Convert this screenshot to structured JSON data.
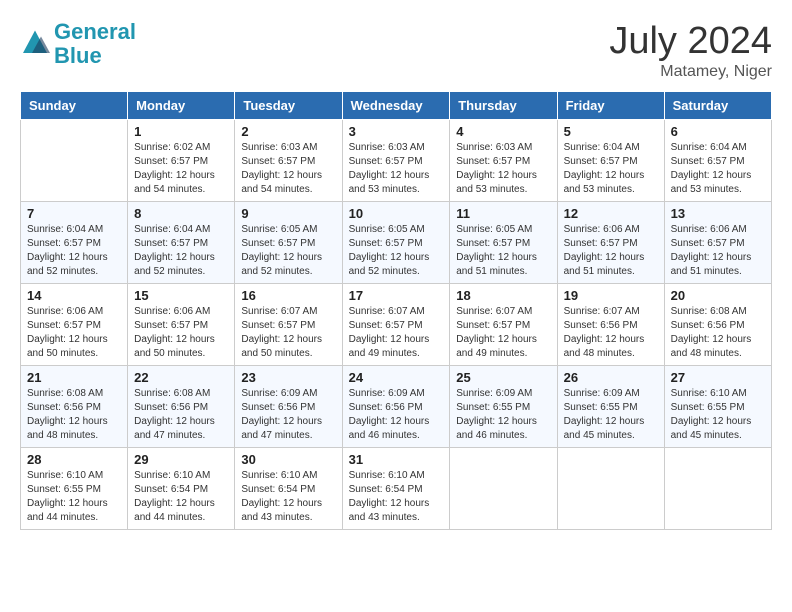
{
  "header": {
    "logo_line1": "General",
    "logo_line2": "Blue",
    "month_year": "July 2024",
    "location": "Matamey, Niger"
  },
  "weekdays": [
    "Sunday",
    "Monday",
    "Tuesday",
    "Wednesday",
    "Thursday",
    "Friday",
    "Saturday"
  ],
  "weeks": [
    [
      {
        "day": "",
        "info": ""
      },
      {
        "day": "1",
        "info": "Sunrise: 6:02 AM\nSunset: 6:57 PM\nDaylight: 12 hours\nand 54 minutes."
      },
      {
        "day": "2",
        "info": "Sunrise: 6:03 AM\nSunset: 6:57 PM\nDaylight: 12 hours\nand 54 minutes."
      },
      {
        "day": "3",
        "info": "Sunrise: 6:03 AM\nSunset: 6:57 PM\nDaylight: 12 hours\nand 53 minutes."
      },
      {
        "day": "4",
        "info": "Sunrise: 6:03 AM\nSunset: 6:57 PM\nDaylight: 12 hours\nand 53 minutes."
      },
      {
        "day": "5",
        "info": "Sunrise: 6:04 AM\nSunset: 6:57 PM\nDaylight: 12 hours\nand 53 minutes."
      },
      {
        "day": "6",
        "info": "Sunrise: 6:04 AM\nSunset: 6:57 PM\nDaylight: 12 hours\nand 53 minutes."
      }
    ],
    [
      {
        "day": "7",
        "info": "Sunrise: 6:04 AM\nSunset: 6:57 PM\nDaylight: 12 hours\nand 52 minutes."
      },
      {
        "day": "8",
        "info": "Sunrise: 6:04 AM\nSunset: 6:57 PM\nDaylight: 12 hours\nand 52 minutes."
      },
      {
        "day": "9",
        "info": "Sunrise: 6:05 AM\nSunset: 6:57 PM\nDaylight: 12 hours\nand 52 minutes."
      },
      {
        "day": "10",
        "info": "Sunrise: 6:05 AM\nSunset: 6:57 PM\nDaylight: 12 hours\nand 52 minutes."
      },
      {
        "day": "11",
        "info": "Sunrise: 6:05 AM\nSunset: 6:57 PM\nDaylight: 12 hours\nand 51 minutes."
      },
      {
        "day": "12",
        "info": "Sunrise: 6:06 AM\nSunset: 6:57 PM\nDaylight: 12 hours\nand 51 minutes."
      },
      {
        "day": "13",
        "info": "Sunrise: 6:06 AM\nSunset: 6:57 PM\nDaylight: 12 hours\nand 51 minutes."
      }
    ],
    [
      {
        "day": "14",
        "info": "Sunrise: 6:06 AM\nSunset: 6:57 PM\nDaylight: 12 hours\nand 50 minutes."
      },
      {
        "day": "15",
        "info": "Sunrise: 6:06 AM\nSunset: 6:57 PM\nDaylight: 12 hours\nand 50 minutes."
      },
      {
        "day": "16",
        "info": "Sunrise: 6:07 AM\nSunset: 6:57 PM\nDaylight: 12 hours\nand 50 minutes."
      },
      {
        "day": "17",
        "info": "Sunrise: 6:07 AM\nSunset: 6:57 PM\nDaylight: 12 hours\nand 49 minutes."
      },
      {
        "day": "18",
        "info": "Sunrise: 6:07 AM\nSunset: 6:57 PM\nDaylight: 12 hours\nand 49 minutes."
      },
      {
        "day": "19",
        "info": "Sunrise: 6:07 AM\nSunset: 6:56 PM\nDaylight: 12 hours\nand 48 minutes."
      },
      {
        "day": "20",
        "info": "Sunrise: 6:08 AM\nSunset: 6:56 PM\nDaylight: 12 hours\nand 48 minutes."
      }
    ],
    [
      {
        "day": "21",
        "info": "Sunrise: 6:08 AM\nSunset: 6:56 PM\nDaylight: 12 hours\nand 48 minutes."
      },
      {
        "day": "22",
        "info": "Sunrise: 6:08 AM\nSunset: 6:56 PM\nDaylight: 12 hours\nand 47 minutes."
      },
      {
        "day": "23",
        "info": "Sunrise: 6:09 AM\nSunset: 6:56 PM\nDaylight: 12 hours\nand 47 minutes."
      },
      {
        "day": "24",
        "info": "Sunrise: 6:09 AM\nSunset: 6:56 PM\nDaylight: 12 hours\nand 46 minutes."
      },
      {
        "day": "25",
        "info": "Sunrise: 6:09 AM\nSunset: 6:55 PM\nDaylight: 12 hours\nand 46 minutes."
      },
      {
        "day": "26",
        "info": "Sunrise: 6:09 AM\nSunset: 6:55 PM\nDaylight: 12 hours\nand 45 minutes."
      },
      {
        "day": "27",
        "info": "Sunrise: 6:10 AM\nSunset: 6:55 PM\nDaylight: 12 hours\nand 45 minutes."
      }
    ],
    [
      {
        "day": "28",
        "info": "Sunrise: 6:10 AM\nSunset: 6:55 PM\nDaylight: 12 hours\nand 44 minutes."
      },
      {
        "day": "29",
        "info": "Sunrise: 6:10 AM\nSunset: 6:54 PM\nDaylight: 12 hours\nand 44 minutes."
      },
      {
        "day": "30",
        "info": "Sunrise: 6:10 AM\nSunset: 6:54 PM\nDaylight: 12 hours\nand 43 minutes."
      },
      {
        "day": "31",
        "info": "Sunrise: 6:10 AM\nSunset: 6:54 PM\nDaylight: 12 hours\nand 43 minutes."
      },
      {
        "day": "",
        "info": ""
      },
      {
        "day": "",
        "info": ""
      },
      {
        "day": "",
        "info": ""
      }
    ]
  ]
}
